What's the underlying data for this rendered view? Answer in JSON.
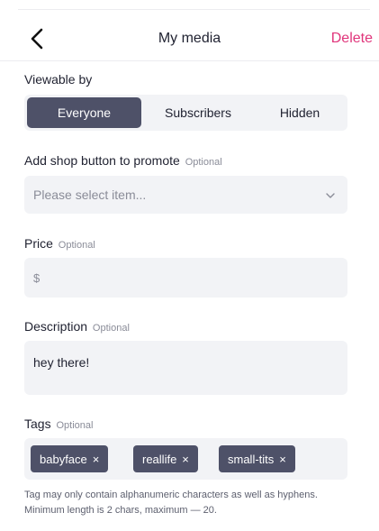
{
  "header": {
    "title": "My media",
    "delete_label": "Delete"
  },
  "viewable": {
    "label": "Viewable by",
    "options": [
      "Everyone",
      "Subscribers",
      "Hidden"
    ],
    "selected": "Everyone"
  },
  "shop": {
    "label": "Add shop button to promote",
    "optional": "Optional",
    "placeholder": "Please select item..."
  },
  "price": {
    "label": "Price",
    "optional": "Optional",
    "prefix": "$"
  },
  "description": {
    "label": "Description",
    "optional": "Optional",
    "value": "hey there!"
  },
  "tags": {
    "label": "Tags",
    "optional": "Optional",
    "items": [
      "babyface",
      "reallife",
      "small-tits"
    ],
    "remove_glyph": "×",
    "hint": "Tag may only contain alphanumeric characters as well as hyphens. Minimum length is 2 chars, maximum — 20."
  },
  "colors": {
    "accent": "#e0357b",
    "active_segment": "#4e5168",
    "field_bg": "#f2f3f6"
  }
}
